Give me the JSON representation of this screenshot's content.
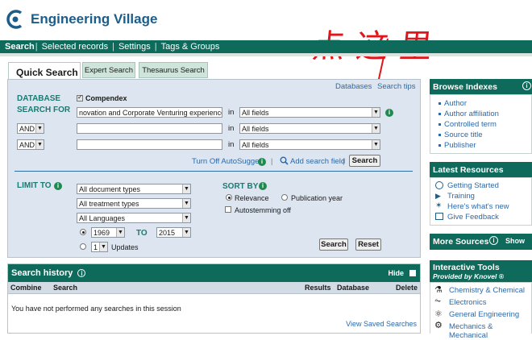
{
  "brand": {
    "name": "Engineering Village"
  },
  "nav": {
    "items": [
      "Search",
      "Selected records",
      "Settings",
      "Tags & Groups"
    ]
  },
  "annotation": {
    "text": "点这里"
  },
  "tabs": {
    "quick": "Quick Search",
    "expert": "Expert Search",
    "thesaurus": "Thesaurus Search"
  },
  "search": {
    "database_label": "DATABASE",
    "database_name": "Compendex",
    "search_for_label": "SEARCH FOR",
    "databases_link": "Databases",
    "tips_link": "Search tips",
    "row1_value": "novation and Corporate Venturing experiences",
    "connector1": "AND",
    "connector2": "AND",
    "in_label": "in",
    "field_select": "All fields",
    "autosuggest": "Turn Off AutoSuggest",
    "add_field": "Add search field",
    "search_button": "Search"
  },
  "limit": {
    "label": "LIMIT TO",
    "doc_types": "All document types",
    "treatment": "All treatment types",
    "languages": "All Languages",
    "year_from": "1969",
    "to_label": "TO",
    "year_to": "2015",
    "updates_count": "1",
    "updates_label": "Updates"
  },
  "sort": {
    "label": "SORT BY",
    "relevance": "Relevance",
    "pub_year": "Publication year",
    "autostem": "Autostemming off",
    "search_button": "Search",
    "reset_button": "Reset"
  },
  "history": {
    "title": "Search history",
    "hide": "Hide",
    "cols": [
      "Combine",
      "Search",
      "Results",
      "Database",
      "Delete"
    ],
    "empty": "You have not performed any searches in this session",
    "saved_link": "View Saved Searches"
  },
  "browse": {
    "title": "Browse Indexes",
    "items": [
      "Author",
      "Author affiliation",
      "Controlled term",
      "Source title",
      "Publisher"
    ]
  },
  "resources": {
    "title": "Latest Resources",
    "items": [
      "Getting Started",
      "Training",
      "Here's what's new",
      "Give Feedback"
    ]
  },
  "more_sources": {
    "title": "More Sources",
    "show": "Show"
  },
  "tools": {
    "title": "Interactive Tools",
    "subtitle": "Provided by Knovel ®",
    "items": [
      "Chemistry & Chemical",
      "Electronics",
      "General Engineering",
      "Mechanics & Mechanical"
    ]
  },
  "colors": {
    "teal": "#0e6a5a",
    "link": "#2c69a8",
    "panel": "#dde6f0",
    "annotation": "#e0161b"
  }
}
